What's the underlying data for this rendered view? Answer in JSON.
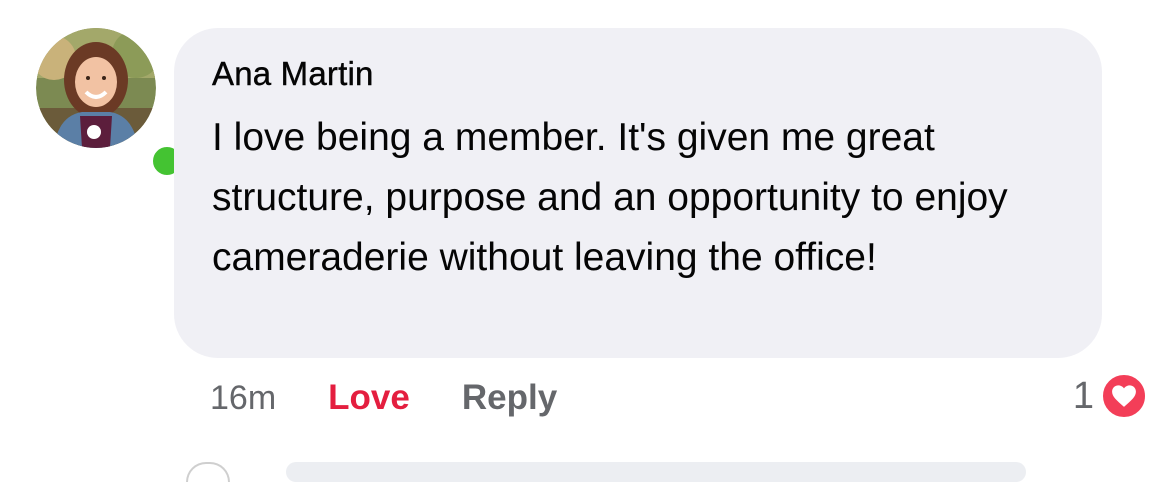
{
  "comment": {
    "author": "Ana Martin",
    "text": "I love being a member. It's given me great structure, purpose and an opportunity to enjoy cameraderie without leaving the office!",
    "online": true
  },
  "actions": {
    "timestamp": "16m",
    "love_label": "Love",
    "reply_label": "Reply"
  },
  "reactions": {
    "count": "1",
    "icon": "heart-icon"
  },
  "colors": {
    "bubble_bg": "#f0f0f5",
    "love_red": "#e41e3f",
    "secondary_text": "#65676b",
    "online_green": "#44c332",
    "react_heart": "#f33e58"
  }
}
